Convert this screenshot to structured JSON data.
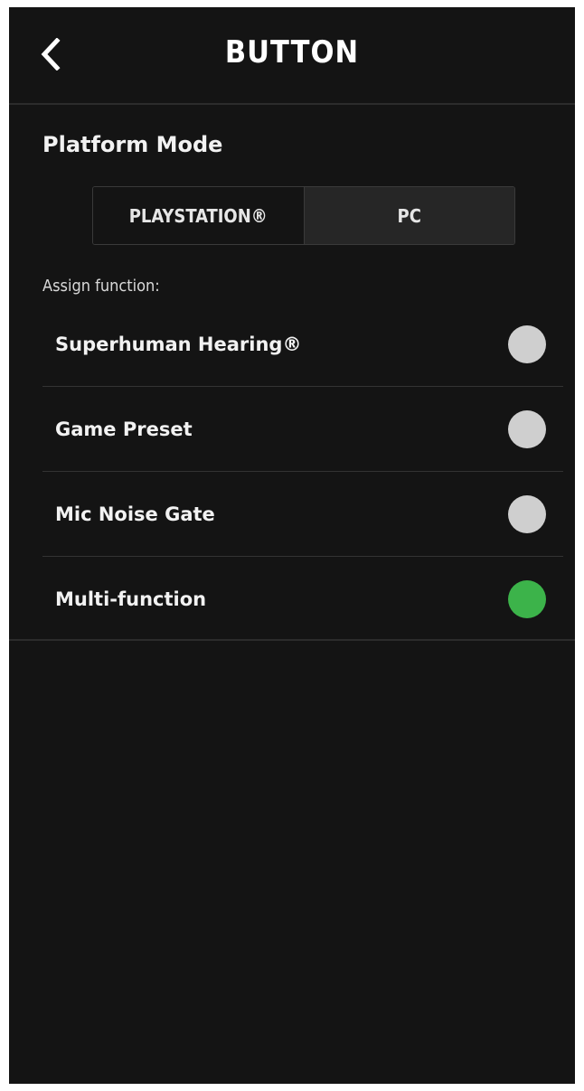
{
  "header": {
    "back_icon": "chevron-left-icon",
    "title": "BUTTON"
  },
  "platform_mode": {
    "title": "Platform Mode",
    "options": [
      "PLAYSTATION®",
      "PC"
    ],
    "selected": "PC"
  },
  "assign": {
    "label": "Assign function:",
    "options": [
      {
        "label": "Superhuman Hearing®",
        "selected": false
      },
      {
        "label": "Game Preset",
        "selected": false
      },
      {
        "label": "Mic Noise Gate",
        "selected": false
      },
      {
        "label": "Multi-function",
        "selected": true
      }
    ]
  },
  "colors": {
    "background": "#141414",
    "radio_off": "#cfcfcf",
    "radio_on": "#3cb34a",
    "segment_selected": "#262626"
  }
}
